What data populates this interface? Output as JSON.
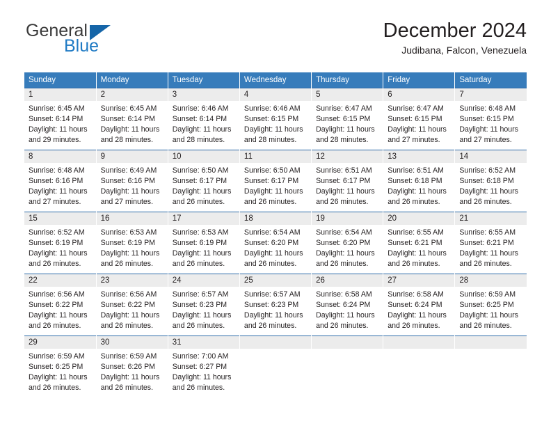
{
  "brand": {
    "name_top": "General",
    "name_bottom": "Blue",
    "colors": {
      "general": "#3a3a3a",
      "blue": "#1f7ac4",
      "triangle": "#1565a8"
    }
  },
  "header": {
    "title": "December 2024",
    "subtitle": "Judibana, Falcon, Venezuela"
  },
  "theme": {
    "header_bg": "#377cbb",
    "header_text": "#ffffff",
    "daynum_bg": "#ececec",
    "row_border": "#2c6aa8"
  },
  "calendar": {
    "weekdays": [
      "Sunday",
      "Monday",
      "Tuesday",
      "Wednesday",
      "Thursday",
      "Friday",
      "Saturday"
    ],
    "weeks": [
      [
        {
          "day": "1",
          "sunrise": "Sunrise: 6:45 AM",
          "sunset": "Sunset: 6:14 PM",
          "daylight1": "Daylight: 11 hours",
          "daylight2": "and 29 minutes."
        },
        {
          "day": "2",
          "sunrise": "Sunrise: 6:45 AM",
          "sunset": "Sunset: 6:14 PM",
          "daylight1": "Daylight: 11 hours",
          "daylight2": "and 28 minutes."
        },
        {
          "day": "3",
          "sunrise": "Sunrise: 6:46 AM",
          "sunset": "Sunset: 6:14 PM",
          "daylight1": "Daylight: 11 hours",
          "daylight2": "and 28 minutes."
        },
        {
          "day": "4",
          "sunrise": "Sunrise: 6:46 AM",
          "sunset": "Sunset: 6:15 PM",
          "daylight1": "Daylight: 11 hours",
          "daylight2": "and 28 minutes."
        },
        {
          "day": "5",
          "sunrise": "Sunrise: 6:47 AM",
          "sunset": "Sunset: 6:15 PM",
          "daylight1": "Daylight: 11 hours",
          "daylight2": "and 28 minutes."
        },
        {
          "day": "6",
          "sunrise": "Sunrise: 6:47 AM",
          "sunset": "Sunset: 6:15 PM",
          "daylight1": "Daylight: 11 hours",
          "daylight2": "and 27 minutes."
        },
        {
          "day": "7",
          "sunrise": "Sunrise: 6:48 AM",
          "sunset": "Sunset: 6:15 PM",
          "daylight1": "Daylight: 11 hours",
          "daylight2": "and 27 minutes."
        }
      ],
      [
        {
          "day": "8",
          "sunrise": "Sunrise: 6:48 AM",
          "sunset": "Sunset: 6:16 PM",
          "daylight1": "Daylight: 11 hours",
          "daylight2": "and 27 minutes."
        },
        {
          "day": "9",
          "sunrise": "Sunrise: 6:49 AM",
          "sunset": "Sunset: 6:16 PM",
          "daylight1": "Daylight: 11 hours",
          "daylight2": "and 27 minutes."
        },
        {
          "day": "10",
          "sunrise": "Sunrise: 6:50 AM",
          "sunset": "Sunset: 6:17 PM",
          "daylight1": "Daylight: 11 hours",
          "daylight2": "and 26 minutes."
        },
        {
          "day": "11",
          "sunrise": "Sunrise: 6:50 AM",
          "sunset": "Sunset: 6:17 PM",
          "daylight1": "Daylight: 11 hours",
          "daylight2": "and 26 minutes."
        },
        {
          "day": "12",
          "sunrise": "Sunrise: 6:51 AM",
          "sunset": "Sunset: 6:17 PM",
          "daylight1": "Daylight: 11 hours",
          "daylight2": "and 26 minutes."
        },
        {
          "day": "13",
          "sunrise": "Sunrise: 6:51 AM",
          "sunset": "Sunset: 6:18 PM",
          "daylight1": "Daylight: 11 hours",
          "daylight2": "and 26 minutes."
        },
        {
          "day": "14",
          "sunrise": "Sunrise: 6:52 AM",
          "sunset": "Sunset: 6:18 PM",
          "daylight1": "Daylight: 11 hours",
          "daylight2": "and 26 minutes."
        }
      ],
      [
        {
          "day": "15",
          "sunrise": "Sunrise: 6:52 AM",
          "sunset": "Sunset: 6:19 PM",
          "daylight1": "Daylight: 11 hours",
          "daylight2": "and 26 minutes."
        },
        {
          "day": "16",
          "sunrise": "Sunrise: 6:53 AM",
          "sunset": "Sunset: 6:19 PM",
          "daylight1": "Daylight: 11 hours",
          "daylight2": "and 26 minutes."
        },
        {
          "day": "17",
          "sunrise": "Sunrise: 6:53 AM",
          "sunset": "Sunset: 6:19 PM",
          "daylight1": "Daylight: 11 hours",
          "daylight2": "and 26 minutes."
        },
        {
          "day": "18",
          "sunrise": "Sunrise: 6:54 AM",
          "sunset": "Sunset: 6:20 PM",
          "daylight1": "Daylight: 11 hours",
          "daylight2": "and 26 minutes."
        },
        {
          "day": "19",
          "sunrise": "Sunrise: 6:54 AM",
          "sunset": "Sunset: 6:20 PM",
          "daylight1": "Daylight: 11 hours",
          "daylight2": "and 26 minutes."
        },
        {
          "day": "20",
          "sunrise": "Sunrise: 6:55 AM",
          "sunset": "Sunset: 6:21 PM",
          "daylight1": "Daylight: 11 hours",
          "daylight2": "and 26 minutes."
        },
        {
          "day": "21",
          "sunrise": "Sunrise: 6:55 AM",
          "sunset": "Sunset: 6:21 PM",
          "daylight1": "Daylight: 11 hours",
          "daylight2": "and 26 minutes."
        }
      ],
      [
        {
          "day": "22",
          "sunrise": "Sunrise: 6:56 AM",
          "sunset": "Sunset: 6:22 PM",
          "daylight1": "Daylight: 11 hours",
          "daylight2": "and 26 minutes."
        },
        {
          "day": "23",
          "sunrise": "Sunrise: 6:56 AM",
          "sunset": "Sunset: 6:22 PM",
          "daylight1": "Daylight: 11 hours",
          "daylight2": "and 26 minutes."
        },
        {
          "day": "24",
          "sunrise": "Sunrise: 6:57 AM",
          "sunset": "Sunset: 6:23 PM",
          "daylight1": "Daylight: 11 hours",
          "daylight2": "and 26 minutes."
        },
        {
          "day": "25",
          "sunrise": "Sunrise: 6:57 AM",
          "sunset": "Sunset: 6:23 PM",
          "daylight1": "Daylight: 11 hours",
          "daylight2": "and 26 minutes."
        },
        {
          "day": "26",
          "sunrise": "Sunrise: 6:58 AM",
          "sunset": "Sunset: 6:24 PM",
          "daylight1": "Daylight: 11 hours",
          "daylight2": "and 26 minutes."
        },
        {
          "day": "27",
          "sunrise": "Sunrise: 6:58 AM",
          "sunset": "Sunset: 6:24 PM",
          "daylight1": "Daylight: 11 hours",
          "daylight2": "and 26 minutes."
        },
        {
          "day": "28",
          "sunrise": "Sunrise: 6:59 AM",
          "sunset": "Sunset: 6:25 PM",
          "daylight1": "Daylight: 11 hours",
          "daylight2": "and 26 minutes."
        }
      ],
      [
        {
          "day": "29",
          "sunrise": "Sunrise: 6:59 AM",
          "sunset": "Sunset: 6:25 PM",
          "daylight1": "Daylight: 11 hours",
          "daylight2": "and 26 minutes."
        },
        {
          "day": "30",
          "sunrise": "Sunrise: 6:59 AM",
          "sunset": "Sunset: 6:26 PM",
          "daylight1": "Daylight: 11 hours",
          "daylight2": "and 26 minutes."
        },
        {
          "day": "31",
          "sunrise": "Sunrise: 7:00 AM",
          "sunset": "Sunset: 6:27 PM",
          "daylight1": "Daylight: 11 hours",
          "daylight2": "and 26 minutes."
        },
        {
          "day": "",
          "sunrise": "",
          "sunset": "",
          "daylight1": "",
          "daylight2": ""
        },
        {
          "day": "",
          "sunrise": "",
          "sunset": "",
          "daylight1": "",
          "daylight2": ""
        },
        {
          "day": "",
          "sunrise": "",
          "sunset": "",
          "daylight1": "",
          "daylight2": ""
        },
        {
          "day": "",
          "sunrise": "",
          "sunset": "",
          "daylight1": "",
          "daylight2": ""
        }
      ]
    ]
  }
}
